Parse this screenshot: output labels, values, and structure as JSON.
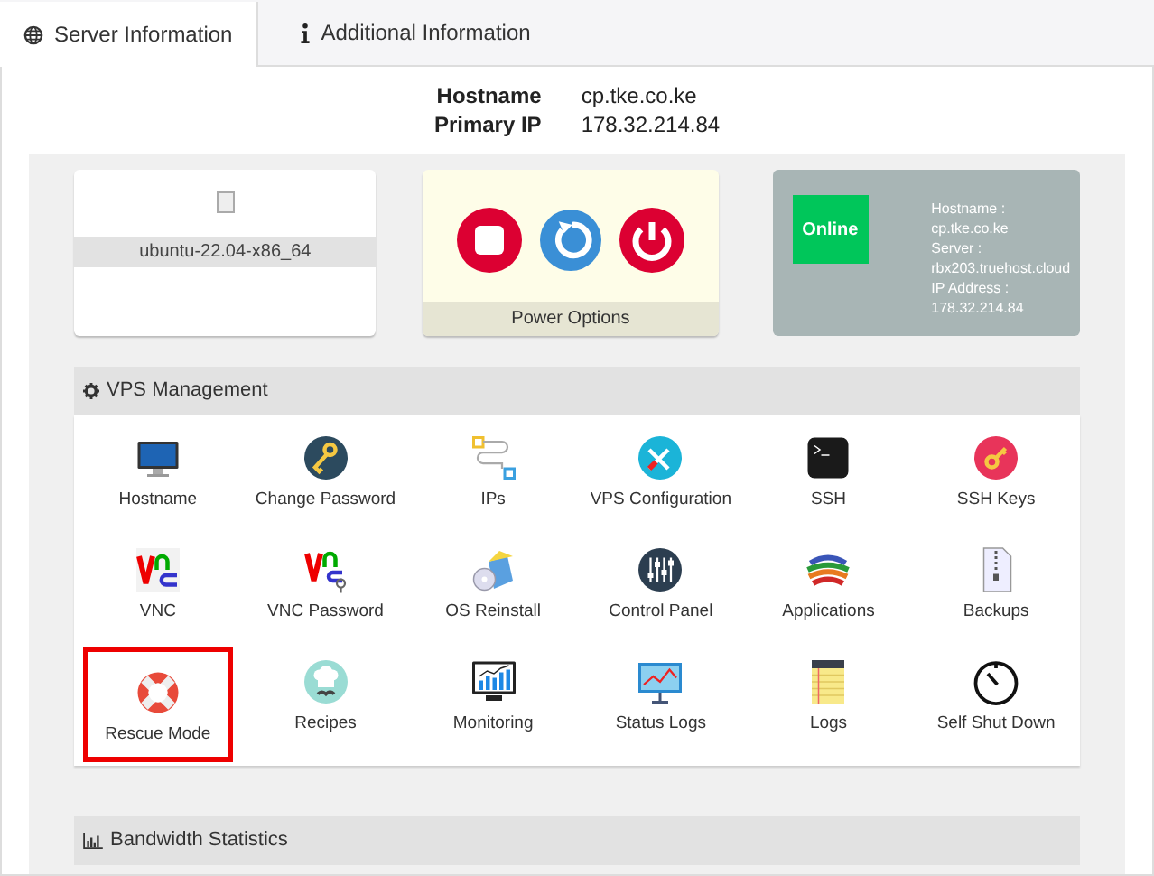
{
  "tabs": [
    {
      "label": "Server Information",
      "selected": true
    },
    {
      "label": "Additional Information",
      "selected": false
    }
  ],
  "summary": [
    {
      "label": "Hostname",
      "value": "cp.tke.co.ke"
    },
    {
      "label": "Primary IP",
      "value": "178.32.214.84"
    }
  ],
  "os_card": {
    "name": "ubuntu-22.04-x86_64"
  },
  "power_card": {
    "title": "Power Options"
  },
  "status_card": {
    "status": "Online",
    "details": [
      "Hostname :",
      "cp.tke.co.ke",
      "Server :",
      "rbx203.truehost.cloud",
      "IP Address :",
      "178.32.214.84"
    ]
  },
  "vps_management": {
    "title": "VPS Management",
    "tiles": [
      {
        "label": "Hostname",
        "selected": false
      },
      {
        "label": "Change Password",
        "selected": false
      },
      {
        "label": "IPs",
        "selected": false
      },
      {
        "label": "VPS Configuration",
        "selected": false
      },
      {
        "label": "SSH",
        "selected": false
      },
      {
        "label": "SSH Keys",
        "selected": false
      },
      {
        "label": "VNC",
        "selected": false
      },
      {
        "label": "VNC Password",
        "selected": false
      },
      {
        "label": "OS Reinstall",
        "selected": false
      },
      {
        "label": "Control Panel",
        "selected": false
      },
      {
        "label": "Applications",
        "selected": false
      },
      {
        "label": "Backups",
        "selected": false
      },
      {
        "label": "Rescue Mode",
        "selected": true
      },
      {
        "label": "Recipes",
        "selected": false
      },
      {
        "label": "Monitoring",
        "selected": false
      },
      {
        "label": "Status Logs",
        "selected": false
      },
      {
        "label": "Logs",
        "selected": false
      },
      {
        "label": "Self Shut Down",
        "selected": false
      }
    ]
  },
  "bandwidth": {
    "title": "Bandwidth Statistics"
  }
}
